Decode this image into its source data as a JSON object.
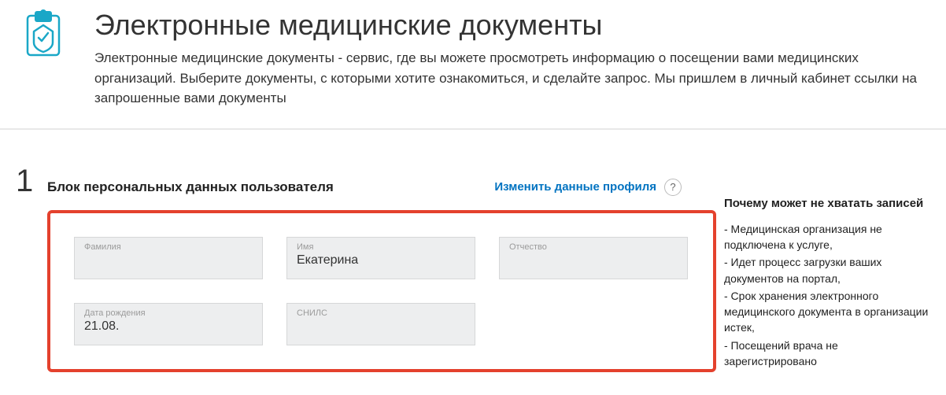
{
  "header": {
    "title": "Электронные медицинские документы",
    "subtitle": "Электронные медицинские документы - сервис, где вы можете просмотреть информацию о посещении вами медицинских организаций. Выберите документы, с которыми хотите ознакомиться, и сделайте запрос. Мы пришлем в личный кабинет ссылки на запрошенные вами документы"
  },
  "step": {
    "number": "1",
    "title": "Блок персональных данных пользователя",
    "edit_link": "Изменить данные профиля",
    "help": "?"
  },
  "fields": {
    "surname": {
      "label": "Фамилия",
      "value": ""
    },
    "name": {
      "label": "Имя",
      "value": "Екатерина"
    },
    "patronymic": {
      "label": "Отчество",
      "value": ""
    },
    "birthdate": {
      "label": "Дата рождения",
      "value": "21.08."
    },
    "snils": {
      "label": "СНИЛС",
      "value": ""
    }
  },
  "sidebar": {
    "title": "Почему может не хватать записей",
    "items": [
      "- Медицинская организация не подключена к услуге,",
      "- Идет процесс загрузки ваших документов на портал,",
      "- Срок хранения электронного медицинского документа в организации истек,",
      "- Посещений врача не зарегистрировано"
    ]
  }
}
